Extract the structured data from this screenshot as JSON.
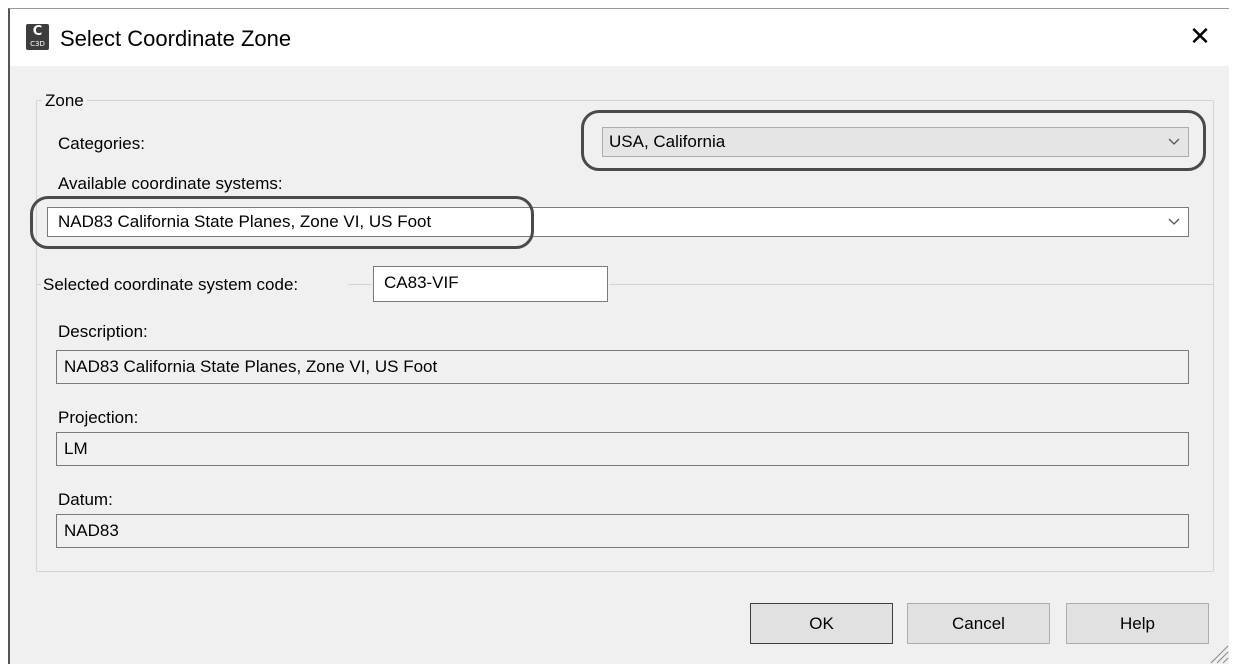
{
  "window": {
    "title": "Select Coordinate Zone",
    "app_icon": {
      "letter": "C",
      "caption": "C3D"
    },
    "close_glyph": "✕"
  },
  "zone": {
    "group_label": "Zone",
    "categories_label": "Categories:",
    "categories_value": "USA, California",
    "available_label": "Available coordinate systems:",
    "available_value": "NAD83 California State Planes, Zone VI, US Foot"
  },
  "selected": {
    "code_label": "Selected coordinate system code:",
    "code_value": "CA83-VIF",
    "description_label": "Description:",
    "description_value": "NAD83 California State Planes, Zone VI, US Foot",
    "projection_label": "Projection:",
    "projection_value": "LM",
    "datum_label": "Datum:",
    "datum_value": "NAD83"
  },
  "buttons": {
    "ok": "OK",
    "cancel": "Cancel",
    "help": "Help"
  },
  "icons": [
    "close-icon",
    "chevron-down-icon",
    "resize-grip-icon"
  ],
  "colors": {
    "dialog_bg": "#f0f0f0",
    "titlebar_bg": "#ffffff",
    "highlight_ring": "#4a4a4a"
  }
}
